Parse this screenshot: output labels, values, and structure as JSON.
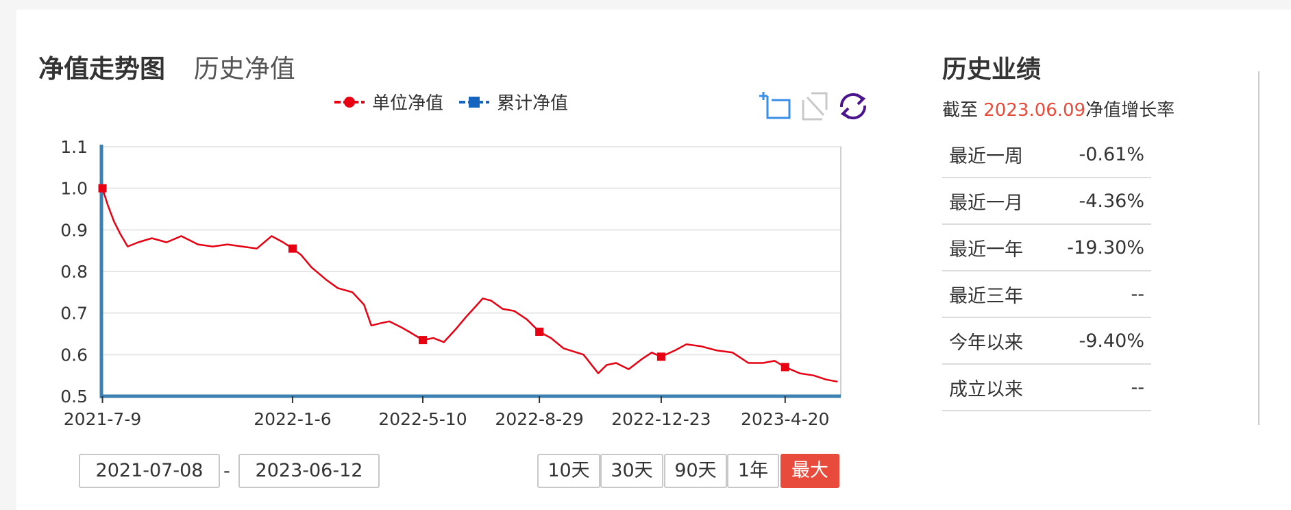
{
  "tabs": {
    "active": "净值走势图",
    "inactive": "历史净值"
  },
  "legend": [
    {
      "label": "单位净值",
      "color": "#e60012",
      "marker": "circle"
    },
    {
      "label": "累计净值",
      "color": "#1565c0",
      "marker": "square"
    }
  ],
  "toolbox": {
    "zoom_icon": "zoom-select-icon",
    "back_icon": "zoom-back-icon",
    "restore_icon": "restore-icon"
  },
  "date_range": {
    "start": "2021-07-08",
    "separator": "-",
    "end": "2023-06-12"
  },
  "range_buttons": [
    {
      "label": "10天",
      "active": false
    },
    {
      "label": "30天",
      "active": false
    },
    {
      "label": "90天",
      "active": false
    },
    {
      "label": "1年",
      "active": false
    },
    {
      "label": "最大",
      "active": true
    }
  ],
  "performance": {
    "title": "历史业绩",
    "subtitle_prefix": "截至 ",
    "subtitle_date": "2023.06.09",
    "subtitle_suffix": "净值增长率",
    "rows": [
      {
        "label": "最近一周",
        "value": "-0.61%"
      },
      {
        "label": "最近一月",
        "value": "-4.36%"
      },
      {
        "label": "最近一年",
        "value": "-19.30%"
      },
      {
        "label": "最近三年",
        "value": "--"
      },
      {
        "label": "今年以来",
        "value": "-9.40%"
      },
      {
        "label": "成立以来",
        "value": "--"
      }
    ]
  },
  "colors": {
    "accent": "#e84b3c",
    "line": "#e60012",
    "axis": "#3c7fb1",
    "grid": "#e6e6e6"
  },
  "chart_data": {
    "type": "line",
    "x_ticks": [
      "2021-7-9",
      "2022-1-6",
      "2022-5-10",
      "2022-8-29",
      "2022-12-23",
      "2023-4-20"
    ],
    "y_ticks": [
      "0.5",
      "0.6",
      "0.7",
      "0.8",
      "0.9",
      "1.0",
      "1.1"
    ],
    "ylim": [
      0.5,
      1.1
    ],
    "xlim": [
      "2021-07-08",
      "2023-06-12"
    ],
    "grid": true,
    "series": [
      {
        "name": "单位净值",
        "points": [
          [
            "2021-07-09",
            1.0
          ],
          [
            "2021-07-14",
            0.96
          ],
          [
            "2021-07-20",
            0.92
          ],
          [
            "2021-07-26",
            0.89
          ],
          [
            "2021-08-02",
            0.86
          ],
          [
            "2021-08-12",
            0.87
          ],
          [
            "2021-08-25",
            0.88
          ],
          [
            "2021-09-08",
            0.87
          ],
          [
            "2021-09-22",
            0.885
          ],
          [
            "2021-10-08",
            0.865
          ],
          [
            "2021-10-22",
            0.86
          ],
          [
            "2021-11-05",
            0.865
          ],
          [
            "2021-11-19",
            0.86
          ],
          [
            "2021-12-03",
            0.855
          ],
          [
            "2021-12-17",
            0.885
          ],
          [
            "2021-12-28",
            0.87
          ],
          [
            "2022-01-06",
            0.855
          ],
          [
            "2022-01-14",
            0.84
          ],
          [
            "2022-01-24",
            0.81
          ],
          [
            "2022-02-07",
            0.78
          ],
          [
            "2022-02-18",
            0.76
          ],
          [
            "2022-03-04",
            0.75
          ],
          [
            "2022-03-15",
            0.72
          ],
          [
            "2022-03-22",
            0.67
          ],
          [
            "2022-03-30",
            0.675
          ],
          [
            "2022-04-08",
            0.68
          ],
          [
            "2022-04-20",
            0.665
          ],
          [
            "2022-04-27",
            0.655
          ],
          [
            "2022-05-10",
            0.635
          ],
          [
            "2022-05-20",
            0.64
          ],
          [
            "2022-05-30",
            0.63
          ],
          [
            "2022-06-10",
            0.66
          ],
          [
            "2022-06-20",
            0.69
          ],
          [
            "2022-06-29",
            0.715
          ],
          [
            "2022-07-06",
            0.735
          ],
          [
            "2022-07-14",
            0.73
          ],
          [
            "2022-07-25",
            0.71
          ],
          [
            "2022-08-05",
            0.705
          ],
          [
            "2022-08-17",
            0.685
          ],
          [
            "2022-08-29",
            0.655
          ],
          [
            "2022-09-09",
            0.64
          ],
          [
            "2022-09-21",
            0.615
          ],
          [
            "2022-10-10",
            0.6
          ],
          [
            "2022-10-24",
            0.555
          ],
          [
            "2022-11-01",
            0.575
          ],
          [
            "2022-11-10",
            0.58
          ],
          [
            "2022-11-22",
            0.565
          ],
          [
            "2022-12-05",
            0.59
          ],
          [
            "2022-12-14",
            0.605
          ],
          [
            "2022-12-23",
            0.595
          ],
          [
            "2023-01-05",
            0.61
          ],
          [
            "2023-01-16",
            0.625
          ],
          [
            "2023-01-30",
            0.62
          ],
          [
            "2023-02-14",
            0.61
          ],
          [
            "2023-03-01",
            0.605
          ],
          [
            "2023-03-16",
            0.58
          ],
          [
            "2023-03-30",
            0.58
          ],
          [
            "2023-04-10",
            0.585
          ],
          [
            "2023-04-20",
            0.57
          ],
          [
            "2023-05-04",
            0.555
          ],
          [
            "2023-05-17",
            0.55
          ],
          [
            "2023-05-29",
            0.54
          ],
          [
            "2023-06-09",
            0.535
          ]
        ]
      }
    ]
  }
}
